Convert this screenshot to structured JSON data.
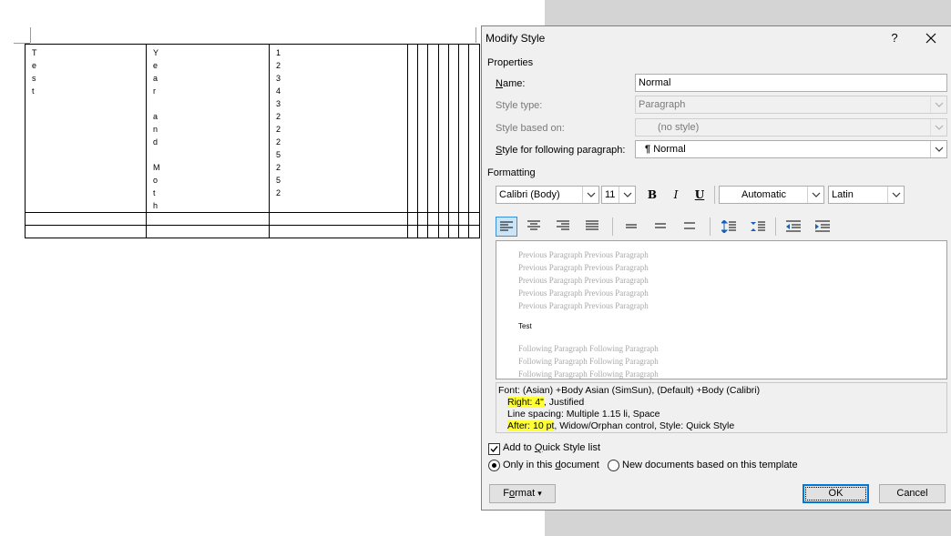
{
  "document": {
    "table_col1_text": "T\ne\ns\nt",
    "table_col2_text": "Y\ne\na\nr\n\na\nn\nd\n\nM\no\nt\nh",
    "table_col3_text": "1\n2\n3\n4\n3\n2\n2\n2\n5\n2\n5\n2"
  },
  "dialog": {
    "title": "Modify Style",
    "help_glyph": "?",
    "properties_label": "Properties",
    "name_label_ul": "N",
    "name_label_rest": "ame:",
    "name_value": "Normal",
    "style_type_label": "Style type:",
    "style_type_value": "Paragraph",
    "style_based_label": "Style based on:",
    "style_based_value": "(no style)",
    "following_label_ul": "S",
    "following_label_rest": "tyle for following paragraph:",
    "following_value": "Normal",
    "following_value_glyph": "¶",
    "formatting_label": "Formatting",
    "font_value": "Calibri (Body)",
    "size_value": "11",
    "bold_glyph": "B",
    "italic_glyph": "I",
    "underline_glyph": "U",
    "color_value": "Automatic",
    "script_value": "Latin",
    "preview_prev": "Previous Paragraph Previous Paragraph",
    "preview_sample": "Test",
    "preview_follow": "Following Paragraph Following Paragraph",
    "desc_line1": "Font: (Asian) +Body Asian (SimSun), (Default) +Body (Calibri)",
    "desc_line2_hl": "Right:  4\"",
    "desc_line2_rest": ", Justified",
    "desc_line3": "Line spacing:  Multiple 1.15 li, Space",
    "desc_line4_hl": "After:  10 pt",
    "desc_line4_rest": ", Widow/Orphan control, Style: Quick Style",
    "add_quick_pre": "Add to ",
    "add_quick_ul": "Q",
    "add_quick_post": "uick Style list",
    "only_doc_pre": "Only in this ",
    "only_doc_ul": "d",
    "only_doc_post": "ocument",
    "new_docs_label": "New documents based on this template",
    "format_pre": "F",
    "format_ul": "o",
    "format_post": "rmat",
    "format_arrow": "▾",
    "ok_label": "OK",
    "cancel_label": "Cancel"
  },
  "colors": {
    "highlight": "#ffff33",
    "accent": "#0078d7",
    "dialog_bg": "#f0f0f0"
  },
  "icons": [
    "close-icon",
    "dropdown-arrow-icon",
    "align-left-icon",
    "align-center-icon",
    "align-right-icon",
    "justify-icon",
    "single-spacing-icon",
    "one-half-spacing-icon",
    "double-spacing-icon",
    "increase-paragraph-spacing-icon",
    "decrease-paragraph-spacing-icon",
    "decrease-indent-icon",
    "increase-indent-icon"
  ]
}
